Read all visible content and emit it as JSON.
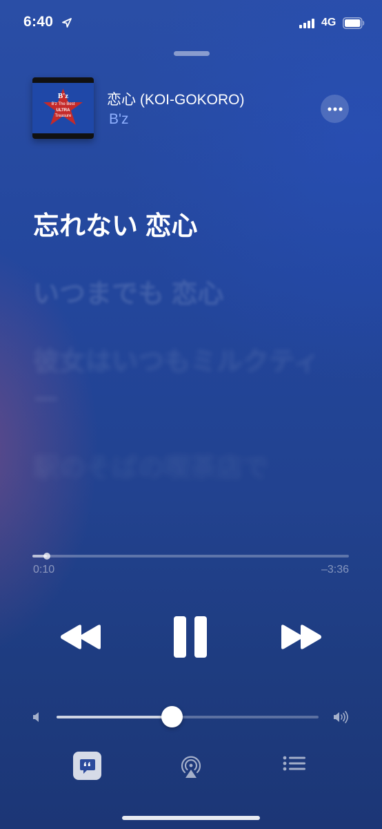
{
  "status_bar": {
    "time": "6:40",
    "network": "4G",
    "icons": [
      "location-arrow-icon",
      "cellular-signal-icon",
      "battery-icon"
    ]
  },
  "now_playing": {
    "title": "恋心 (KOI-GOKORO)",
    "artist": "B'z",
    "artwork_icon": "album-artwork",
    "artwork_text": [
      "B'z",
      "B'z The Best",
      "ULTRA",
      "Treasure"
    ]
  },
  "lyrics": {
    "current": "忘れない 恋心",
    "next": "いつまでも 恋心",
    "next2": "彼女はいつもミルクティー",
    "next3": "駅のそばの喫茶店で"
  },
  "progress": {
    "elapsed": "0:10",
    "remaining": "–3:36",
    "fraction": 0.045
  },
  "volume": {
    "fraction": 0.44
  },
  "controls": {
    "rewind_icon": "rewind-icon",
    "pause_icon": "pause-icon",
    "forward_icon": "fast-forward-icon",
    "lyrics_icon": "lyrics-icon",
    "airplay_icon": "airplay-icon",
    "queue_icon": "queue-list-icon"
  },
  "colors": {
    "background": "#22428f",
    "artist_accent": "#8fb0ff"
  }
}
